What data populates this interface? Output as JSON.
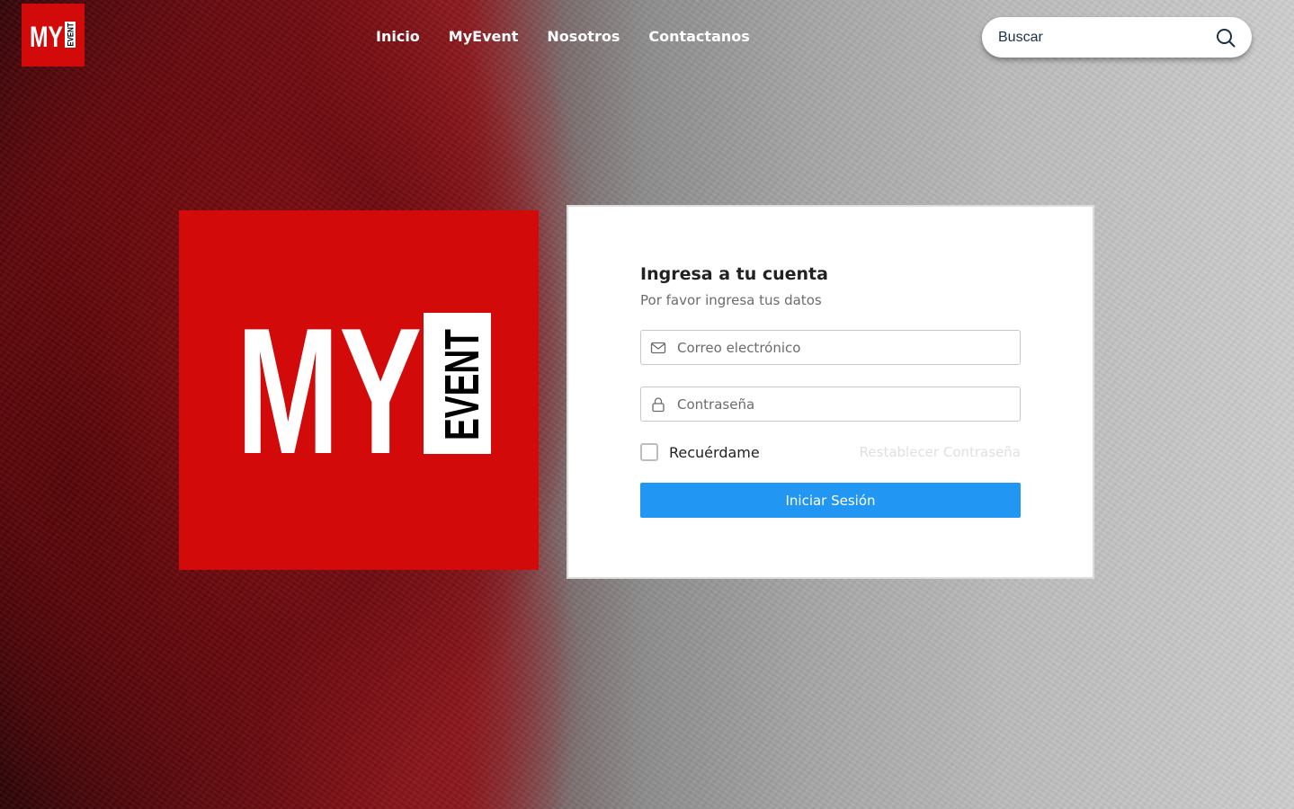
{
  "header": {
    "logo_text": "MY EVENT",
    "nav": [
      {
        "label": "Inicio"
      },
      {
        "label": "MyEvent"
      },
      {
        "label": "Nosotros"
      },
      {
        "label": "Contactanos"
      }
    ],
    "search": {
      "placeholder": "Buscar",
      "icon": "search-icon"
    }
  },
  "hero_logo": {
    "text": "MY EVENT"
  },
  "login": {
    "title": "Ingresa a tu cuenta",
    "subtitle": "Por favor ingresa tus datos",
    "email_placeholder": "Correo electrónico",
    "email_icon": "mail-icon",
    "password_placeholder": "Contraseña",
    "password_icon": "lock-icon",
    "remember_label": "Recuérdame",
    "forgot_label": "Restablecer Contraseña",
    "submit_label": "Iniciar Sesión"
  },
  "colors": {
    "brand_red": "#d30a0a",
    "primary_button": "#2196f3"
  }
}
